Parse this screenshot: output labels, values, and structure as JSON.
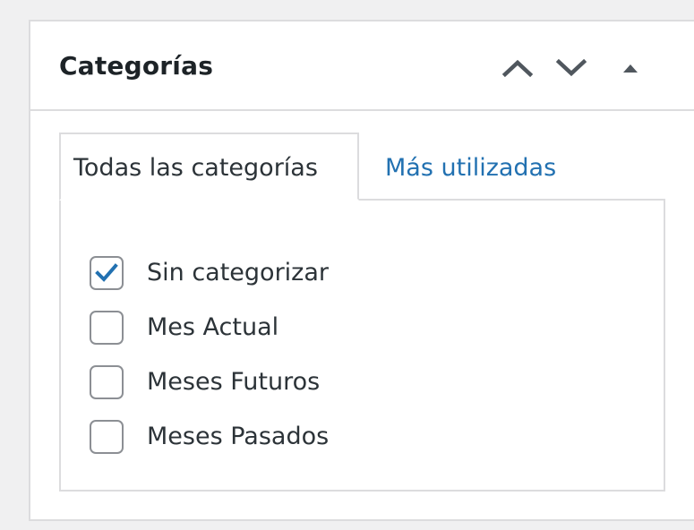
{
  "metabox": {
    "title": "Categorías",
    "controls": [
      {
        "name": "move-up",
        "icon": "chevron-up-icon"
      },
      {
        "name": "move-down",
        "icon": "chevron-down-icon"
      },
      {
        "name": "toggle-panel",
        "icon": "triangle-up-icon"
      }
    ]
  },
  "tabs": [
    {
      "label": "Todas las categorías",
      "active": true
    },
    {
      "label": "Más utilizadas",
      "active": false
    }
  ],
  "categories": [
    {
      "label": "Sin categorizar",
      "checked": true
    },
    {
      "label": "Mes Actual",
      "checked": false
    },
    {
      "label": "Meses Futuros",
      "checked": false
    },
    {
      "label": "Meses Pasados",
      "checked": false
    }
  ],
  "colors": {
    "link": "#2271b1",
    "check": "#2271b1",
    "border": "#dcdcde",
    "text": "#1d2327",
    "background": "#f0f0f1"
  }
}
